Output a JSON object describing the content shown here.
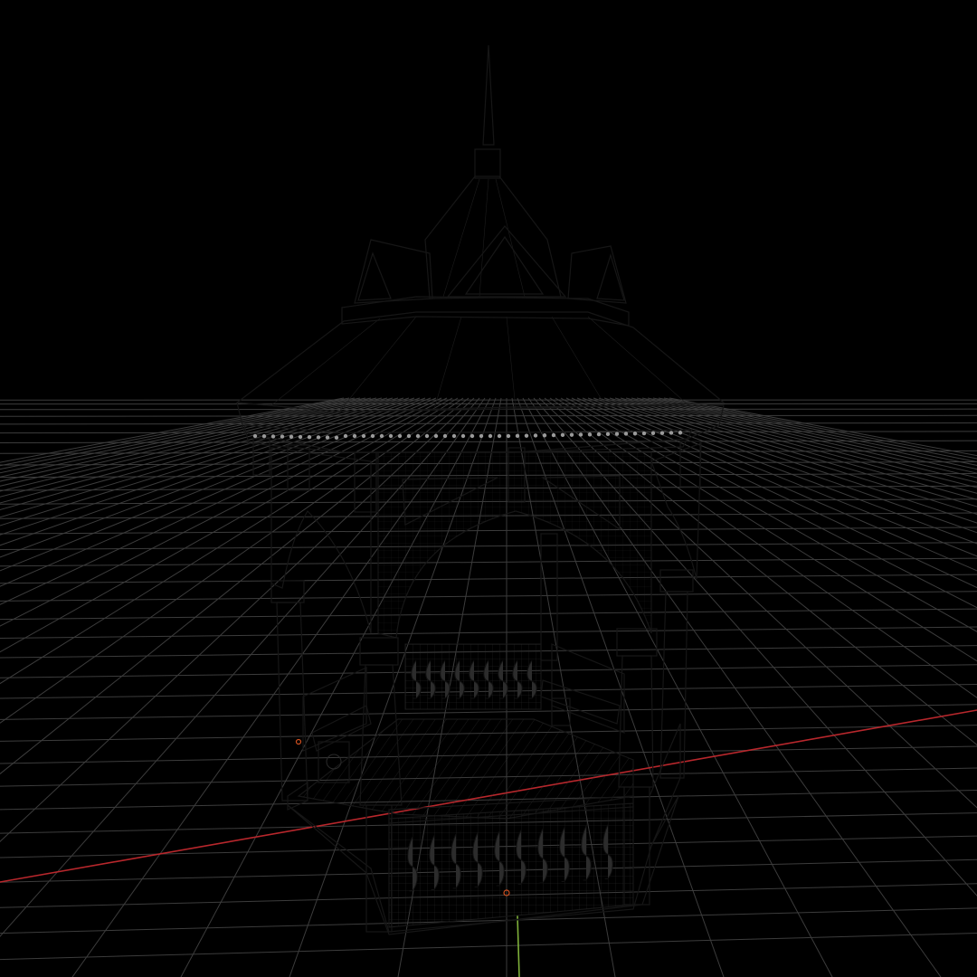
{
  "viewport": {
    "background": "#000000",
    "grid_color": "#3c3c3c",
    "x_axis_color": "#b8272c",
    "y_axis_color": "#7fb03a",
    "model_color": "#8a8a8a",
    "wire_color": "#1a1a1a",
    "shading": "solid-wireframe",
    "model": "octagonal-gazebo"
  }
}
